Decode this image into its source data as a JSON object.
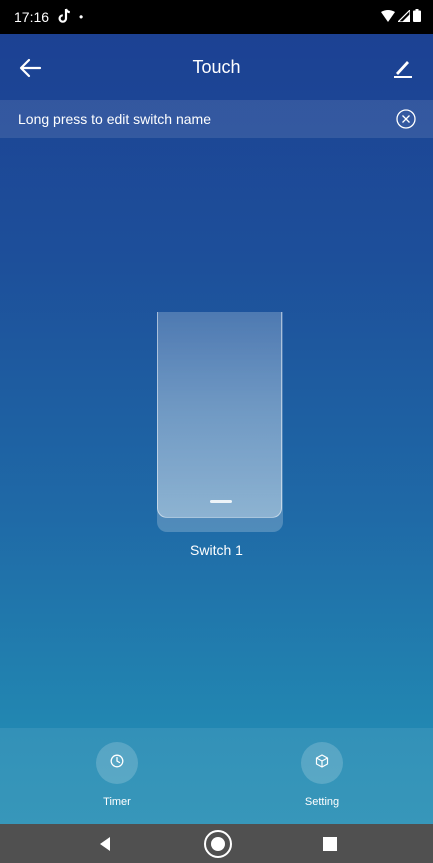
{
  "status_bar": {
    "time": "17:16",
    "dot": "•",
    "icons": [
      "tiktok-icon",
      "wifi-icon",
      "signal-icon",
      "battery-icon"
    ]
  },
  "app_bar": {
    "title": "Touch"
  },
  "notice": {
    "text": "Long press to edit switch name"
  },
  "switch": {
    "label": "Switch 1"
  },
  "actions": [
    {
      "label": "Timer",
      "icon": "clock-icon"
    },
    {
      "label": "Setting",
      "icon": "settings-cube-icon"
    }
  ],
  "colors": {
    "gradient_top": "#1c3f92",
    "gradient_bottom": "#2892b6",
    "nav_bar": "#505050"
  }
}
